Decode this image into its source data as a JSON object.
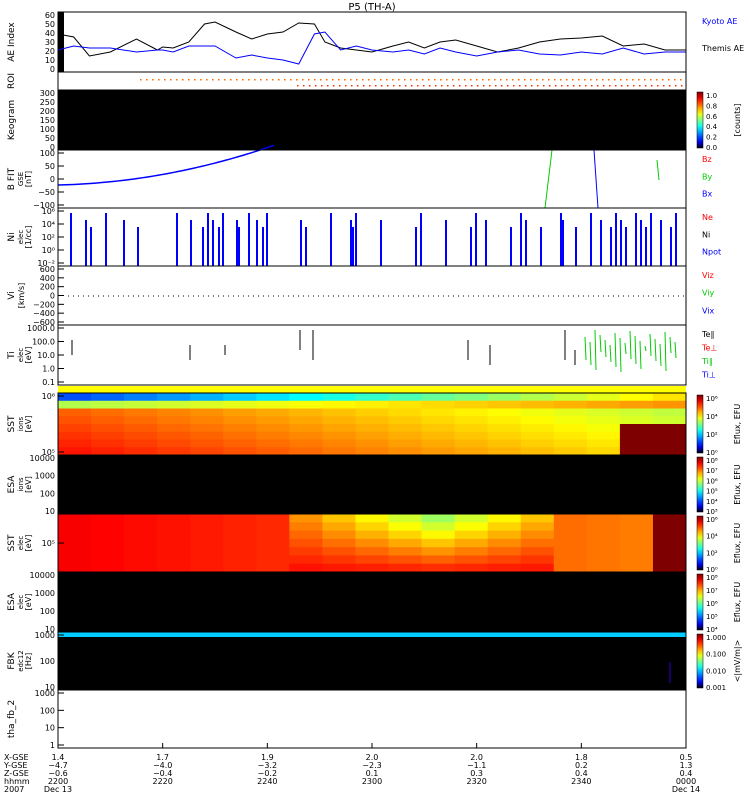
{
  "title": "P5 (TH-A)",
  "chart_data": [
    {
      "type": "line",
      "id": "ae",
      "ylabel": "AE Index",
      "ylim": [
        0,
        60
      ],
      "yticks": [
        "0",
        "10",
        "20",
        "30",
        "40",
        "50",
        "60"
      ],
      "legend": [
        {
          "name": "Kyoto AE",
          "color": "#0000ff"
        },
        {
          "name": "Themis AE",
          "color": "#000000"
        }
      ],
      "x_minutes": [
        0,
        3,
        6,
        10,
        15,
        19,
        20,
        22,
        25,
        28,
        30,
        34,
        37,
        40,
        43,
        46,
        49,
        51,
        54,
        57,
        60,
        64,
        67,
        70,
        73,
        76,
        80,
        84,
        88,
        92,
        96,
        100,
        104,
        108,
        112,
        116,
        120
      ],
      "series": [
        {
          "name": "Themis AE",
          "color": "#000000",
          "values": [
            38,
            35,
            16,
            20,
            33,
            22,
            25,
            24,
            30,
            48,
            50,
            40,
            33,
            38,
            40,
            49,
            48,
            30,
            24,
            22,
            20,
            26,
            30,
            24,
            30,
            32,
            26,
            20,
            24,
            30,
            33,
            34,
            36,
            26,
            28,
            22,
            22
          ]
        },
        {
          "name": "Kyoto AE",
          "color": "#0000ff",
          "values": [
            22,
            26,
            24,
            24,
            20,
            22,
            22,
            20,
            26,
            26,
            26,
            14,
            17,
            14,
            12,
            8,
            38,
            40,
            22,
            26,
            22,
            20,
            22,
            18,
            24,
            20,
            16,
            20,
            22,
            18,
            17,
            20,
            18,
            24,
            18,
            20,
            20
          ]
        }
      ]
    },
    {
      "type": "scatter",
      "id": "roi",
      "ylabel": "ROI",
      "color": "#ff6600"
    },
    {
      "type": "heatmap",
      "id": "keogram",
      "ylabel": "Keogram",
      "ylim": [
        0,
        300
      ],
      "yticks": [
        "0",
        "50",
        "100",
        "150",
        "200",
        "250",
        "300"
      ],
      "colorbar": {
        "label": "[counts]",
        "ticks": [
          "1.0",
          "0.8",
          "0.6",
          "0.4",
          "0.2",
          "0.0"
        ]
      }
    },
    {
      "type": "line",
      "id": "bfit",
      "ylabel": "B FIT",
      "units": "[nT]",
      "sublabel": "GSE",
      "ylim": [
        -100,
        100
      ],
      "yticks": [
        "−100",
        "−50",
        "0",
        "50",
        "100"
      ],
      "legend": [
        {
          "name": "Bz",
          "color": "#ff0000"
        },
        {
          "name": "By",
          "color": "#00cc00"
        },
        {
          "name": "Bx",
          "color": "#0000ff"
        }
      ]
    },
    {
      "type": "bar",
      "id": "ni",
      "ylabel": "Ni",
      "sublabel": "elec",
      "units": "[1/cc]",
      "yticks": [
        "10⁻²",
        "10⁰",
        "10²",
        "10⁴",
        "10⁶"
      ],
      "legend": [
        {
          "name": "Ne",
          "color": "#ff0000"
        },
        {
          "name": "Ni",
          "color": "#000000"
        },
        {
          "name": "Npot",
          "color": "#0000ff"
        }
      ]
    },
    {
      "type": "line",
      "id": "vi",
      "ylabel": "Vi",
      "units": "[km/s]",
      "ylim": [
        -600,
        600
      ],
      "yticks": [
        "−600",
        "−400",
        "−200",
        "0",
        "200",
        "400",
        "600"
      ],
      "legend": [
        {
          "name": "Viz",
          "color": "#ff0000"
        },
        {
          "name": "Viy",
          "color": "#00cc00"
        },
        {
          "name": "Vix",
          "color": "#0000ff"
        }
      ]
    },
    {
      "type": "line",
      "id": "ti",
      "ylabel": "Ti",
      "sublabel": "elec",
      "units": "[eV]",
      "yticks": [
        "0.1",
        "1.0",
        "10.0",
        "100.0",
        "1000.0"
      ],
      "legend": [
        {
          "name": "Te∥",
          "color": "#000000"
        },
        {
          "name": "Te⊥",
          "color": "#ff0000"
        },
        {
          "name": "Ti∥",
          "color": "#00cc00"
        },
        {
          "name": "Ti⊥",
          "color": "#0000ff"
        }
      ]
    },
    {
      "type": "heatmap",
      "id": "sst_i",
      "ylabel": "SST",
      "sublabel": "ions",
      "units": "[eV]",
      "yticks": [
        "10⁵",
        "10⁶"
      ],
      "colorbar": {
        "label": "Eflux, EFU",
        "ticks": [
          "10⁶",
          "10⁴",
          "10²",
          "10⁰"
        ]
      }
    },
    {
      "type": "heatmap",
      "id": "esa_i",
      "ylabel": "ESA",
      "sublabel": "ions",
      "units": "[eV]",
      "yticks": [
        "10",
        "100",
        "1000",
        "10000"
      ],
      "colorbar": {
        "label": "Eflux, EFU",
        "ticks": [
          "10⁸",
          "10⁷",
          "10⁶",
          "10⁵",
          "10⁴",
          "10³"
        ]
      }
    },
    {
      "type": "heatmap",
      "id": "sst_e",
      "ylabel": "SST",
      "sublabel": "elec",
      "units": "[eV]",
      "yticks": [
        "10⁵"
      ],
      "colorbar": {
        "label": "Eflux, EFU",
        "ticks": [
          "10⁶",
          "10⁴",
          "10²",
          "10⁰"
        ]
      }
    },
    {
      "type": "heatmap",
      "id": "esa_e",
      "ylabel": "ESA",
      "sublabel": "elec",
      "units": "[eV]",
      "yticks": [
        "10",
        "100",
        "1000",
        "10000"
      ],
      "colorbar": {
        "label": "Eflux, EFU",
        "ticks": [
          "10⁸",
          "10⁷",
          "10⁶",
          "10⁵",
          "10⁴"
        ]
      }
    },
    {
      "type": "heatmap",
      "id": "fbk",
      "ylabel": "FBK",
      "sublabel": "edc12",
      "units": "[Hz]",
      "yticks": [
        "10",
        "100",
        "1000"
      ],
      "colorbar": {
        "label": "<|mV/m|>",
        "ticks": [
          "1.000",
          "0.100",
          "0.010",
          "0.001"
        ]
      }
    },
    {
      "type": "line",
      "id": "fb2",
      "ylabel": "tha_fb_2",
      "yticks": [
        "1",
        "10",
        "100",
        "1000"
      ]
    }
  ],
  "x_axis": {
    "row_labels": [
      "X-GSE",
      "Y-GSE",
      "Z-GSE",
      "hhmm",
      "2007"
    ],
    "ticks": [
      {
        "x": "1.4",
        "y": "−4.7",
        "z": "−0.6",
        "t": "2200",
        "d": "Dec 13"
      },
      {
        "x": "1.7",
        "y": "−4.0",
        "z": "−0.4",
        "t": "2220",
        "d": ""
      },
      {
        "x": "1.9",
        "y": "−3.2",
        "z": "−0.2",
        "t": "2240",
        "d": ""
      },
      {
        "x": "2.0",
        "y": "−2.3",
        "z": "0.1",
        "t": "2300",
        "d": ""
      },
      {
        "x": "2.0",
        "y": "−1.1",
        "z": "0.3",
        "t": "2320",
        "d": ""
      },
      {
        "x": "1.8",
        "y": "0.2",
        "z": "0.4",
        "t": "2340",
        "d": ""
      },
      {
        "x": "0.5",
        "y": "1.3",
        "z": "0.4",
        "t": "0000",
        "d": "Dec 14"
      }
    ]
  }
}
